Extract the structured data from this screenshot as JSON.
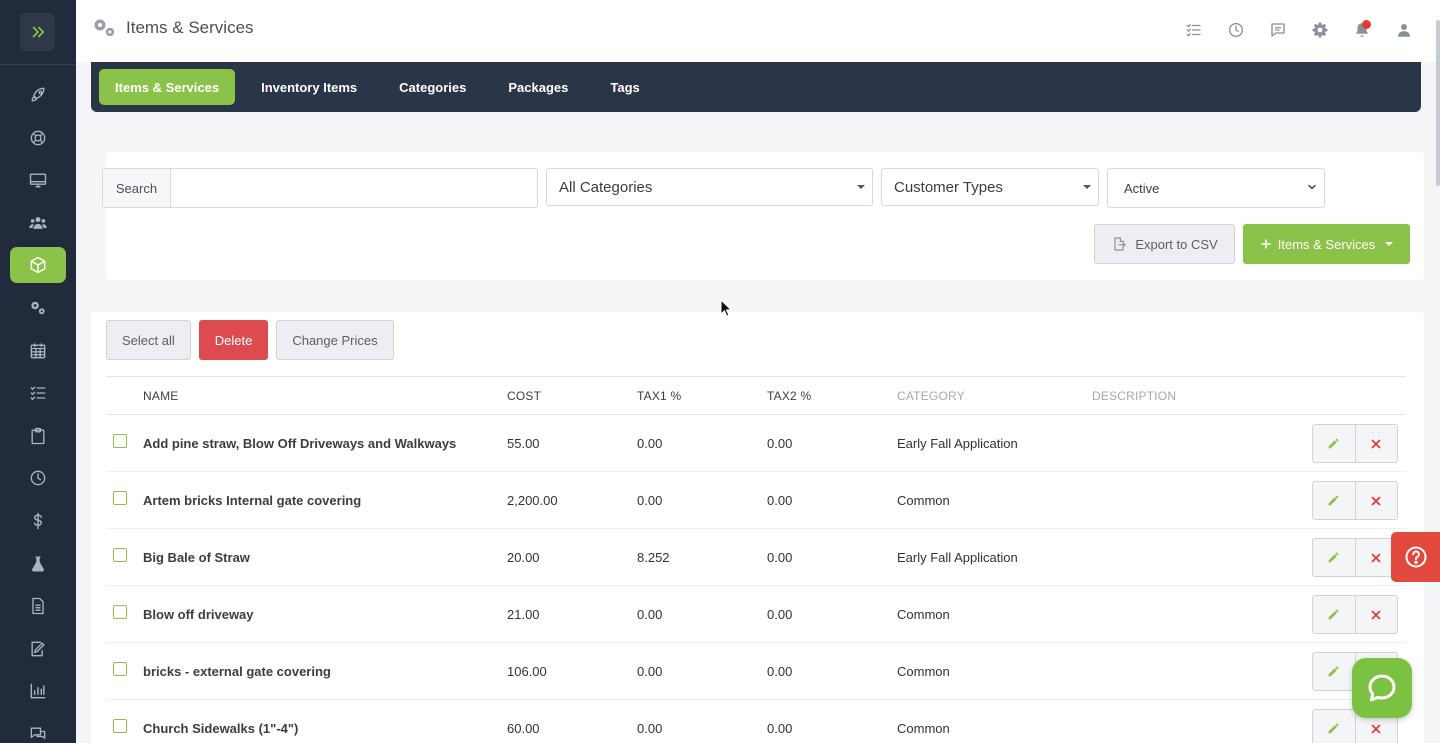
{
  "app": {
    "title": "Items & Services"
  },
  "sidebar": {
    "items": [
      {
        "icon": "rocket-icon"
      },
      {
        "icon": "lifebuoy-icon"
      },
      {
        "icon": "monitor-icon"
      },
      {
        "icon": "users-icon"
      },
      {
        "icon": "box-icon",
        "active": true
      },
      {
        "icon": "gears-icon"
      },
      {
        "icon": "calendar-icon"
      },
      {
        "icon": "checklist-icon"
      },
      {
        "icon": "clipboard-icon"
      },
      {
        "icon": "clock-icon"
      },
      {
        "icon": "dollar-icon"
      },
      {
        "icon": "flask-icon"
      },
      {
        "icon": "document-icon"
      },
      {
        "icon": "edit-document-icon"
      },
      {
        "icon": "bar-chart-icon"
      },
      {
        "icon": "chat-bubbles-icon"
      }
    ],
    "accent": "#8bc34a",
    "background": "#222b3b"
  },
  "topbar": {
    "icons": [
      "checklist-icon",
      "clock-icon",
      "message-icon",
      "gear-icon",
      "bell-icon",
      "user-icon"
    ]
  },
  "tabs": [
    {
      "label": "Items & Services",
      "active": true
    },
    {
      "label": "Inventory Items"
    },
    {
      "label": "Categories"
    },
    {
      "label": "Packages"
    },
    {
      "label": "Tags"
    }
  ],
  "filters": {
    "search_label": "Search",
    "search_value": "",
    "category": "All Categories",
    "customer_types": "Customer Types",
    "status": "Active",
    "export_label": "Export to CSV",
    "add_label": "Items & Services"
  },
  "bulk": {
    "select_all": "Select all",
    "delete": "Delete",
    "change_prices": "Change Prices"
  },
  "table": {
    "columns": [
      "NAME",
      "COST",
      "TAX1 %",
      "TAX2 %",
      "CATEGORY",
      "DESCRIPTION"
    ],
    "rows": [
      {
        "name": "Add pine straw, Blow Off Driveways and Walkways",
        "cost": "55.00",
        "tax1": "0.00",
        "tax2": "0.00",
        "category": "Early Fall Application",
        "description": ""
      },
      {
        "name": "Artem bricks Internal gate covering",
        "cost": "2,200.00",
        "tax1": "0.00",
        "tax2": "0.00",
        "category": "Common",
        "description": ""
      },
      {
        "name": "Big Bale of Straw",
        "cost": "20.00",
        "tax1": "8.252",
        "tax2": "0.00",
        "category": "Early Fall Application",
        "description": ""
      },
      {
        "name": "Blow off driveway",
        "cost": "21.00",
        "tax1": "0.00",
        "tax2": "0.00",
        "category": "Common",
        "description": ""
      },
      {
        "name": "bricks - external gate covering",
        "cost": "106.00",
        "tax1": "0.00",
        "tax2": "0.00",
        "category": "Common",
        "description": ""
      },
      {
        "name": "Church Sidewalks (1\"-4\")",
        "cost": "60.00",
        "tax1": "0.00",
        "tax2": "0.00",
        "category": "Common",
        "description": ""
      }
    ]
  },
  "colors": {
    "accent": "#8bc34a",
    "danger": "#dc4b4f",
    "help": "#e0493b",
    "chat": "#7cc242",
    "nav": "#2b3548"
  }
}
